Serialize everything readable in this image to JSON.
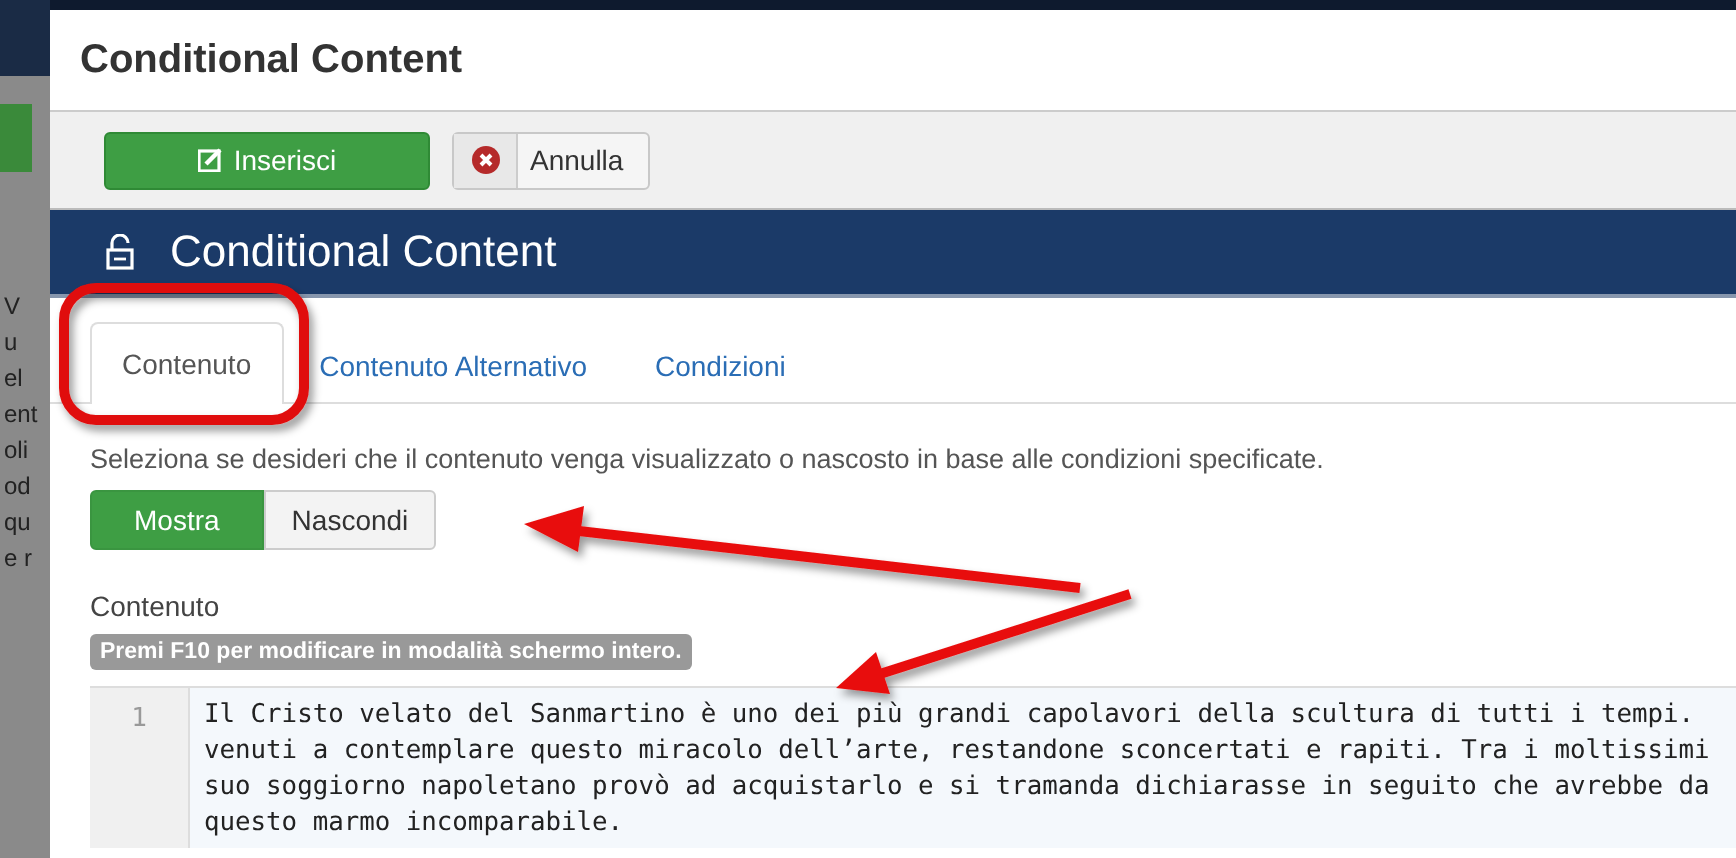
{
  "backdrop": {
    "fragments": [
      "V",
      "u",
      "el",
      "ent",
      "oli",
      "od",
      "qu",
      "e r"
    ]
  },
  "dialog": {
    "title": "Conditional Content"
  },
  "toolbar": {
    "buttons": [
      {
        "label": "Inserisci",
        "kind": "primary"
      },
      {
        "label": "Annulla",
        "kind": "cancel"
      }
    ]
  },
  "header": {
    "title": "Conditional Content"
  },
  "tabs": [
    {
      "label": "Contenuto",
      "selected": true
    },
    {
      "label": "Contenuto Alternativo",
      "selected": false
    },
    {
      "label": "Condizioni",
      "selected": false
    }
  ],
  "description": "Seleziona se desideri che il contenuto venga visualizzato o nascosto in base alle condizioni specificate.",
  "toggle": [
    {
      "label": "Mostra",
      "selected": true
    },
    {
      "label": "Nascondi",
      "selected": false
    }
  ],
  "editor": {
    "label": "Contenuto",
    "hint": "Premi F10 per modificare in modalità schermo intero.",
    "line_number": "1",
    "lines": [
      "Il Cristo velato del Sanmartino è uno dei più grandi capolavori della scultura di tutti i tempi.",
      "venuti a contemplare questo miracolo dell’arte, restandone sconcertati e rapiti. Tra i moltissimi",
      "suo soggiorno napoletano provò ad acquistarlo e si tramanda dichiarasse in seguito che avrebbe da",
      "questo marmo incomparabile."
    ]
  }
}
